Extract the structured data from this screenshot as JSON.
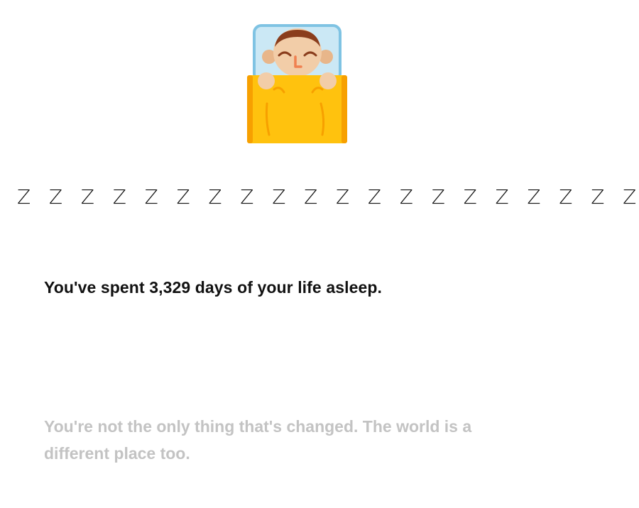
{
  "illustration": {
    "icon": "sleeping-in-bed-icon",
    "colors": {
      "pillow": "#cbe8f5",
      "pillow_border": "#7fc3e3",
      "skin": "#f2cda8",
      "hair": "#8a3d1c",
      "blanket": "#ffc20e",
      "blanket_edge": "#f7a000"
    }
  },
  "zzz": {
    "glyph": "Z",
    "count": 20
  },
  "stat_text": "You've spent 3,329 days of your life asleep.",
  "caption_text": "You're not the only thing that's changed. The world is a different place too."
}
